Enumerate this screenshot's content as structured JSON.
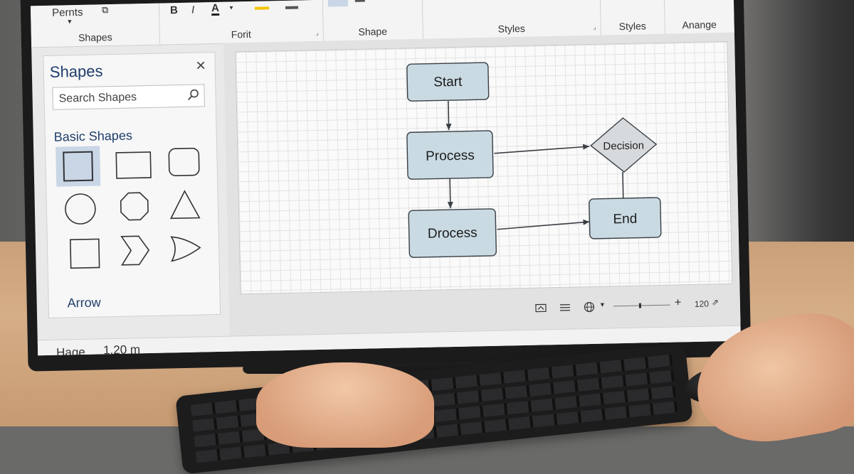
{
  "ribbon": {
    "groups": [
      {
        "label": "Shapes",
        "top_tool": "Pernts"
      },
      {
        "label": "Forit",
        "tools": [
          "B",
          "I",
          "A"
        ]
      },
      {
        "label": "Shape"
      },
      {
        "label": "Styles"
      },
      {
        "label": "Styles"
      },
      {
        "label": "Anange"
      }
    ]
  },
  "shapes_panel": {
    "title": "Shapes",
    "search_placeholder": "Search Shapes",
    "section_basic": "Basic Shapes",
    "basic_shapes": [
      "square",
      "rectangle",
      "rounded-rectangle",
      "circle",
      "octagon",
      "triangle",
      "square",
      "chevron",
      "pointed-shape"
    ],
    "section_arrow": "Arrow"
  },
  "diagram": {
    "nodes": [
      {
        "id": "start",
        "label": "Start",
        "shape": "rounded-rectangle"
      },
      {
        "id": "process",
        "label": "Process",
        "shape": "rounded-rectangle"
      },
      {
        "id": "decision",
        "label": "Decision",
        "shape": "diamond"
      },
      {
        "id": "drocess",
        "label": "Drocess",
        "shape": "rounded-rectangle"
      },
      {
        "id": "end",
        "label": "End",
        "shape": "rounded-rectangle"
      }
    ],
    "edges": [
      {
        "from": "start",
        "to": "process"
      },
      {
        "from": "process",
        "to": "decision"
      },
      {
        "from": "process",
        "to": "drocess"
      },
      {
        "from": "drocess",
        "to": "end"
      },
      {
        "from": "end",
        "to": "decision"
      }
    ],
    "node_fill": "#c9dae3",
    "decision_fill": "#d7dadd",
    "stroke": "#3a3f44"
  },
  "canvas_footer": {
    "zoom": "120"
  },
  "statusbar": {
    "label": "Hage",
    "value": "1,20 m"
  },
  "colors": {
    "accent_text": "#1f3d6b",
    "selection": "#c8d6e6"
  }
}
